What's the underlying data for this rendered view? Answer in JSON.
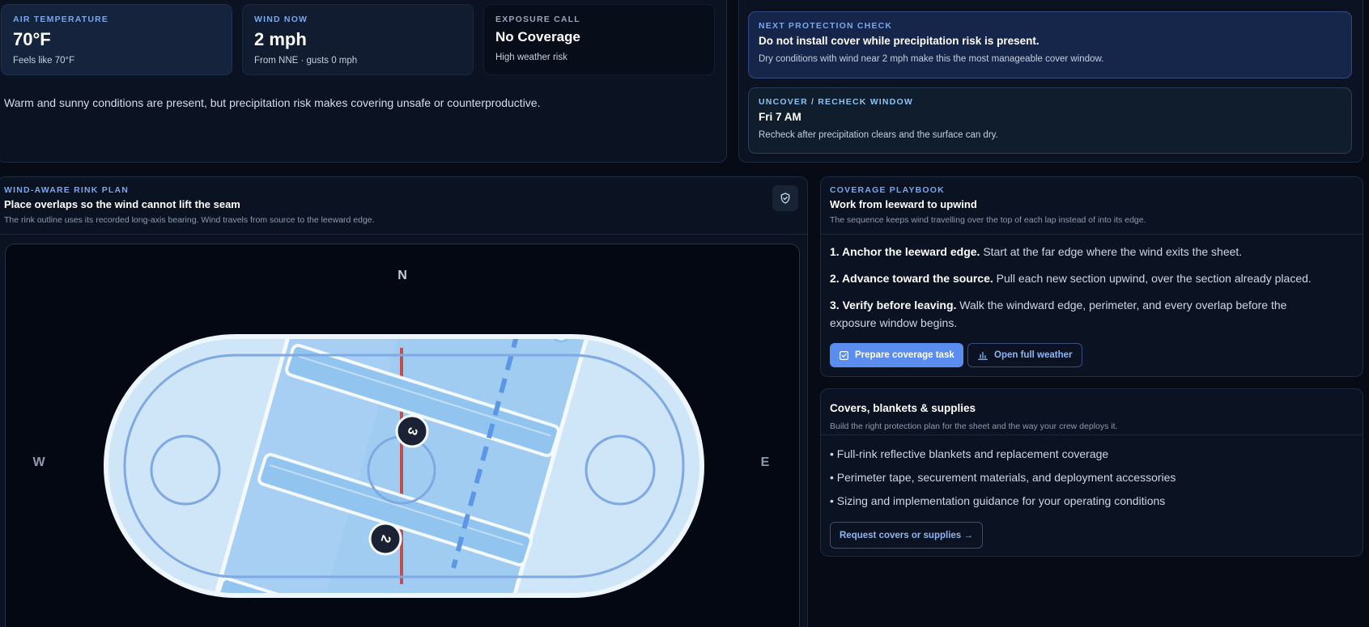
{
  "conditions": {
    "air_temp": {
      "label": "AIR TEMPERATURE",
      "value": "70°F",
      "sub": "Feels like 70°F"
    },
    "wind_now": {
      "label": "WIND NOW",
      "value": "2 mph",
      "sub": "From NNE · gusts 0 mph"
    },
    "exposure": {
      "label": "EXPOSURE CALL",
      "value": "No Coverage",
      "sub": "High weather risk"
    },
    "summary": "Warm and sunny conditions are present, but precipitation risk makes covering unsafe or counterproductive."
  },
  "next_check": {
    "label": "NEXT PROTECTION CHECK",
    "title": "Do not install cover while precipitation risk is present.",
    "body": "Dry conditions with wind near 2 mph make this the most manageable cover window."
  },
  "recheck": {
    "label": "UNCOVER / RECHECK WINDOW",
    "title": "Fri 7 AM",
    "body": "Recheck after precipitation clears and the surface can dry."
  },
  "rink_plan": {
    "label": "WIND-AWARE RINK PLAN",
    "title": "Place overlaps so the wind cannot lift the seam",
    "sub": "The rink outline uses its recorded long-axis bearing. Wind travels from source to the leeward edge.",
    "compass": {
      "n": "N",
      "w": "W",
      "e": "E"
    },
    "markers": {
      "first": "3",
      "second": "2"
    }
  },
  "playbook": {
    "label": "COVERAGE PLAYBOOK",
    "title": "Work from leeward to upwind",
    "sub": "The sequence keeps wind travelling over the top of each lap instead of into its edge.",
    "steps": [
      {
        "lead": "1. Anchor the leeward edge.",
        "text": "Start at the far edge where the wind exits the sheet."
      },
      {
        "lead": "2. Advance toward the source.",
        "text": "Pull each new section upwind, over the section already placed."
      },
      {
        "lead": "3. Verify before leaving.",
        "text": "Walk the windward edge, perimeter, and every overlap before the exposure window begins."
      }
    ],
    "primary_button": "Prepare coverage task",
    "secondary_button": "Open full weather"
  },
  "supplies": {
    "title": "Covers, blankets & supplies",
    "sub": "Build the right protection plan for the sheet and the way your crew deploys it.",
    "items": [
      "• Full-rink reflective blankets and replacement coverage",
      "• Perimeter tape, securement materials, and deployment accessories",
      "• Sizing and implementation guidance for your operating conditions"
    ],
    "button": "Request covers or supplies →"
  },
  "colors": {
    "accent": "#5b8def",
    "kicker": "#7aa7ec",
    "ice": "#cfe5f8",
    "cover": "#a6cff3",
    "red_line": "#c0504d"
  }
}
